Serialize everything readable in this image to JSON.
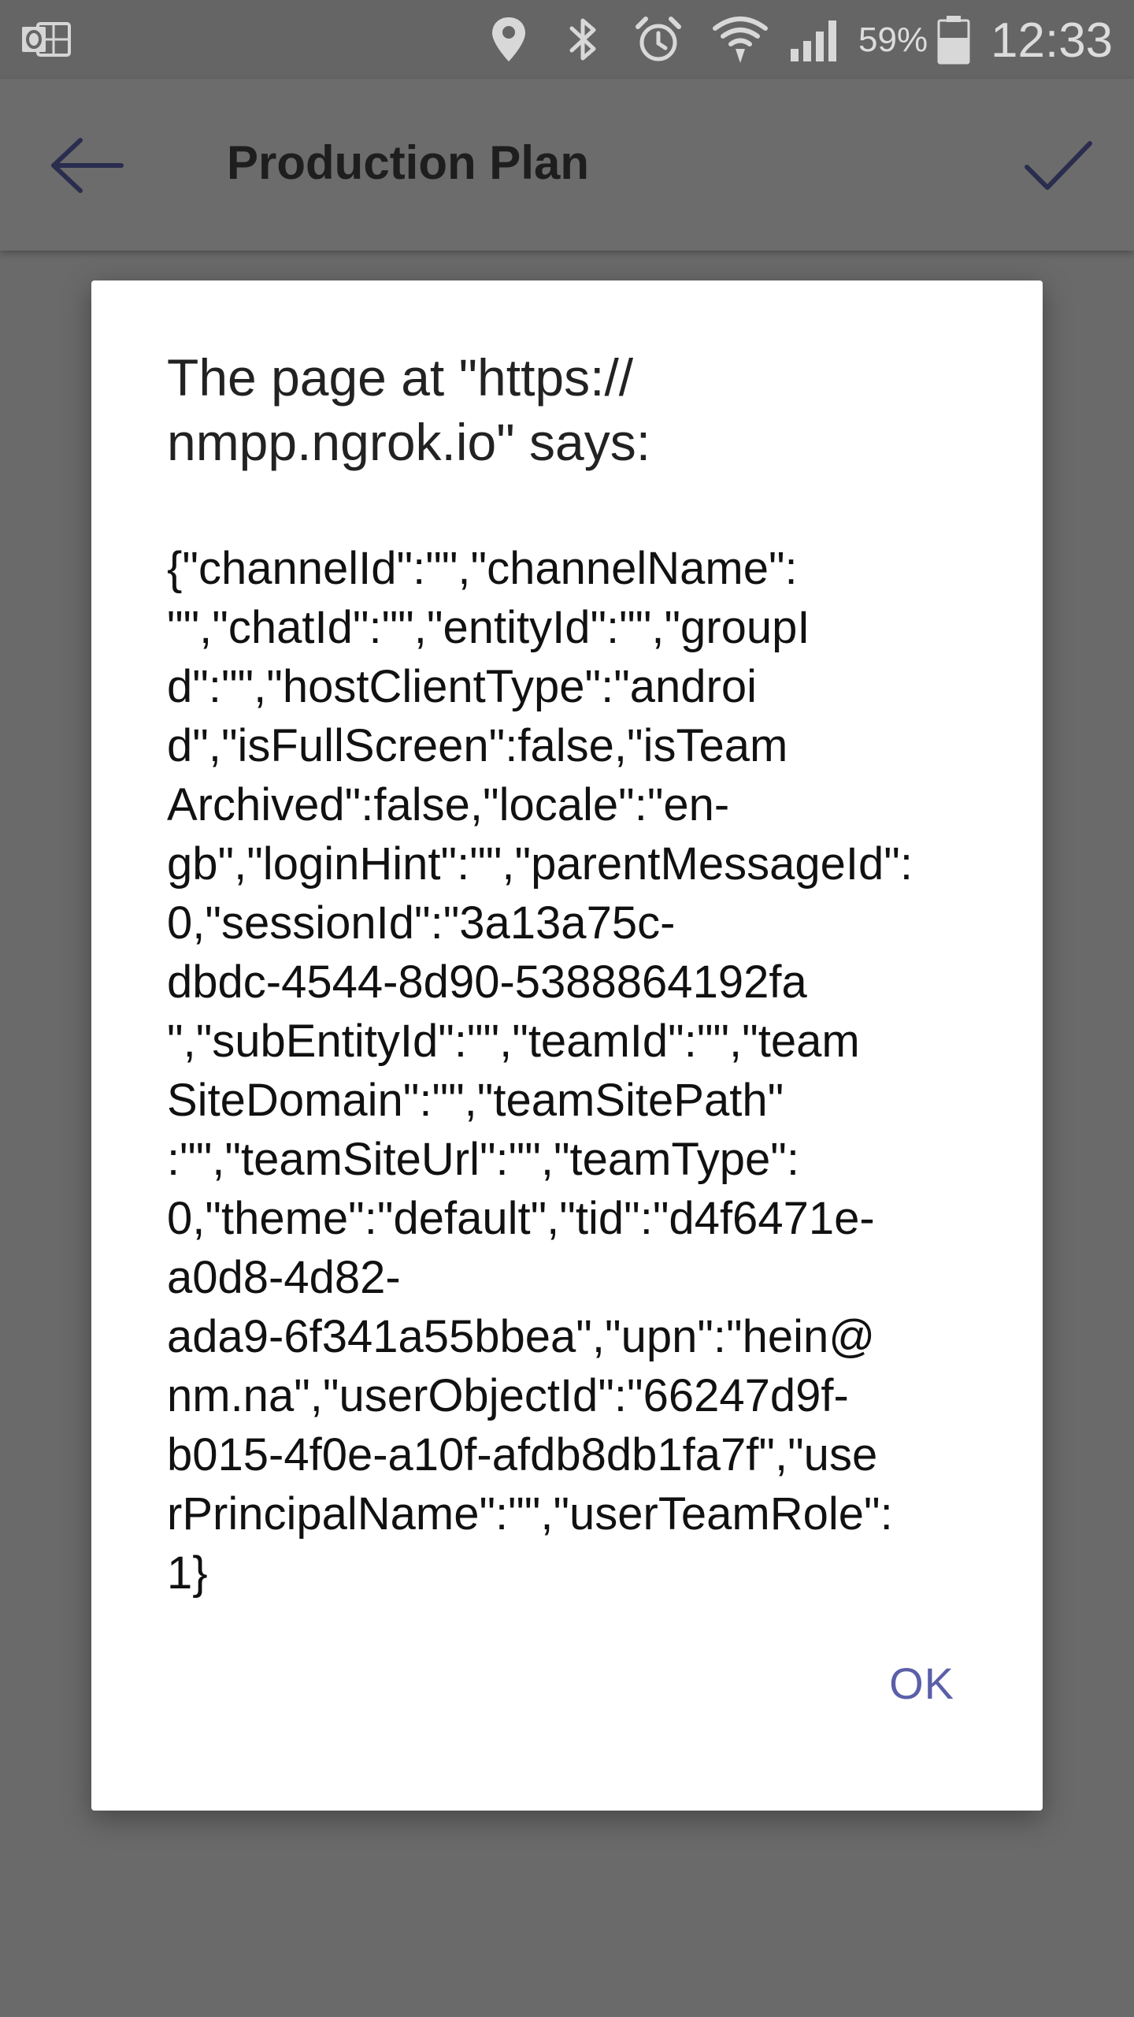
{
  "status_bar": {
    "icons": [
      "outlook-notification-icon",
      "location-icon",
      "bluetooth-icon",
      "alarm-icon",
      "wifi-icon",
      "cell-signal-icon",
      "battery-icon"
    ],
    "battery_percent": "59%",
    "time": "12:33"
  },
  "app_bar": {
    "title": "Production Plan",
    "back_icon": "arrow-left-icon",
    "confirm_icon": "checkmark-icon"
  },
  "dialog": {
    "title_lines": [
      "The page at \"https://",
      "nmpp.ngrok.io\" says:"
    ],
    "message_lines": [
      "{\"channelId\":\"\",\"channelName\":",
      "\"\",\"chatId\":\"\",\"entityId\":\"\",\"groupI",
      "d\":\"\",\"hostClientType\":\"androi",
      "d\",\"isFullScreen\":false,\"isTeam",
      "Archived\":false,\"locale\":\"en-",
      "gb\",\"loginHint\":\"\",\"parentMessageId\":",
      "0,\"sessionId\":\"3a13a75c-",
      "dbdc-4544-8d90-5388864192fa",
      "\",\"subEntityId\":\"\",\"teamId\":\"\",\"team",
      "SiteDomain\":\"\",\"teamSitePath\"",
      ":\"\",\"teamSiteUrl\":\"\",\"teamType\":",
      "0,\"theme\":\"default\",\"tid\":\"d4f6471e-",
      "a0d8-4d82-",
      "ada9-6f341a55bbea\",\"upn\":\"hein@",
      "nm.na\",\"userObjectId\":\"66247d9f-",
      "b015-4f0e-a10f-afdb8db1fa7f\",\"use",
      "rPrincipalName\":\"\",\"userTeamRole\":",
      "1}"
    ],
    "ok_label": "OK"
  },
  "colors": {
    "scrim": "#6a6a6a",
    "dialog_background": "#ffffff",
    "accent": "#5b5fa8",
    "title_text": "#1e1e1e"
  }
}
